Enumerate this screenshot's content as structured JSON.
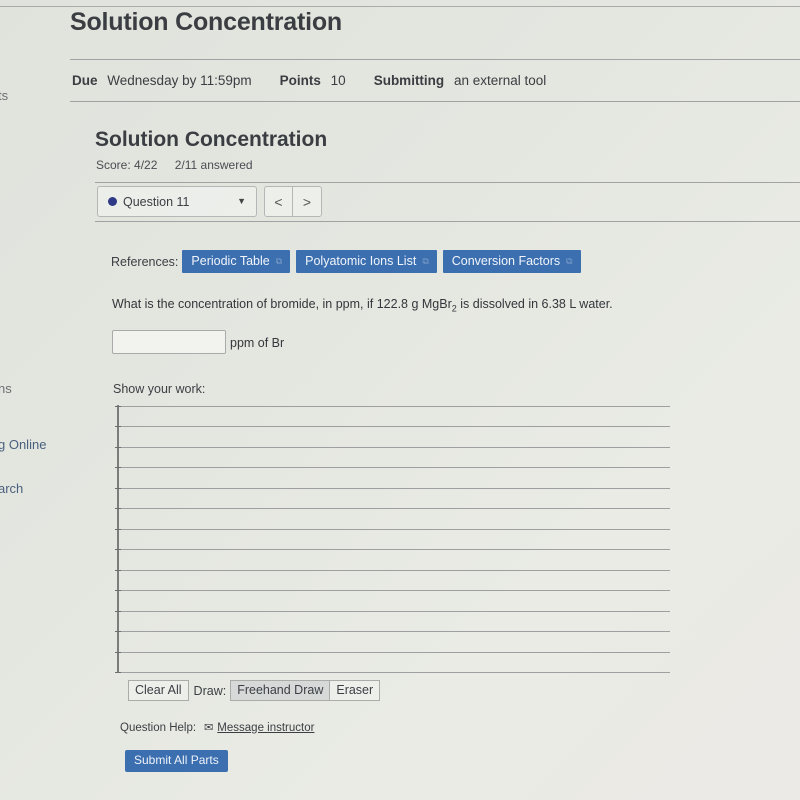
{
  "sidebar": {
    "items": [
      {
        "label": "ts"
      },
      {
        "label": "ns"
      },
      {
        "label": "g Online"
      },
      {
        "label": "arch"
      }
    ]
  },
  "assignment": {
    "title": "Solution Concentration",
    "due_label": "Due",
    "due_value": "Wednesday by 11:59pm",
    "points_label": "Points",
    "points_value": "10",
    "submitting_label": "Submitting",
    "submitting_value": "an external tool"
  },
  "quiz": {
    "title": "Solution Concentration",
    "score": "Score: 4/22",
    "answered": "2/11 answered",
    "question_select": "Question 11",
    "prev_label": "<",
    "next_label": ">"
  },
  "references": {
    "label": "References:",
    "buttons": [
      {
        "label": "Periodic Table",
        "icon": "external-link-icon"
      },
      {
        "label": "Polyatomic Ions List",
        "icon": "external-link-icon"
      },
      {
        "label": "Conversion Factors",
        "icon": "external-link-icon"
      }
    ]
  },
  "question": {
    "text_before": "What is the concentration of bromide, in ppm, if 122.8 g MgBr",
    "subscript": "2",
    "text_after": " is dissolved in 6.38 L water.",
    "answer_value": "",
    "answer_unit": "ppm of Br"
  },
  "work": {
    "label": "Show your work:",
    "line_count": 14
  },
  "draw_tools": {
    "clear_all": "Clear All",
    "draw_label": "Draw:",
    "freehand": "Freehand Draw",
    "eraser": "Eraser",
    "active_tool": "Freehand Draw"
  },
  "help": {
    "label": "Question Help:",
    "icon": "mail-icon",
    "link": "Message instructor"
  },
  "submit": {
    "label": "Submit All Parts"
  },
  "colors": {
    "primary_button": "#3b6fb0",
    "question_dot": "#2e3a86"
  }
}
